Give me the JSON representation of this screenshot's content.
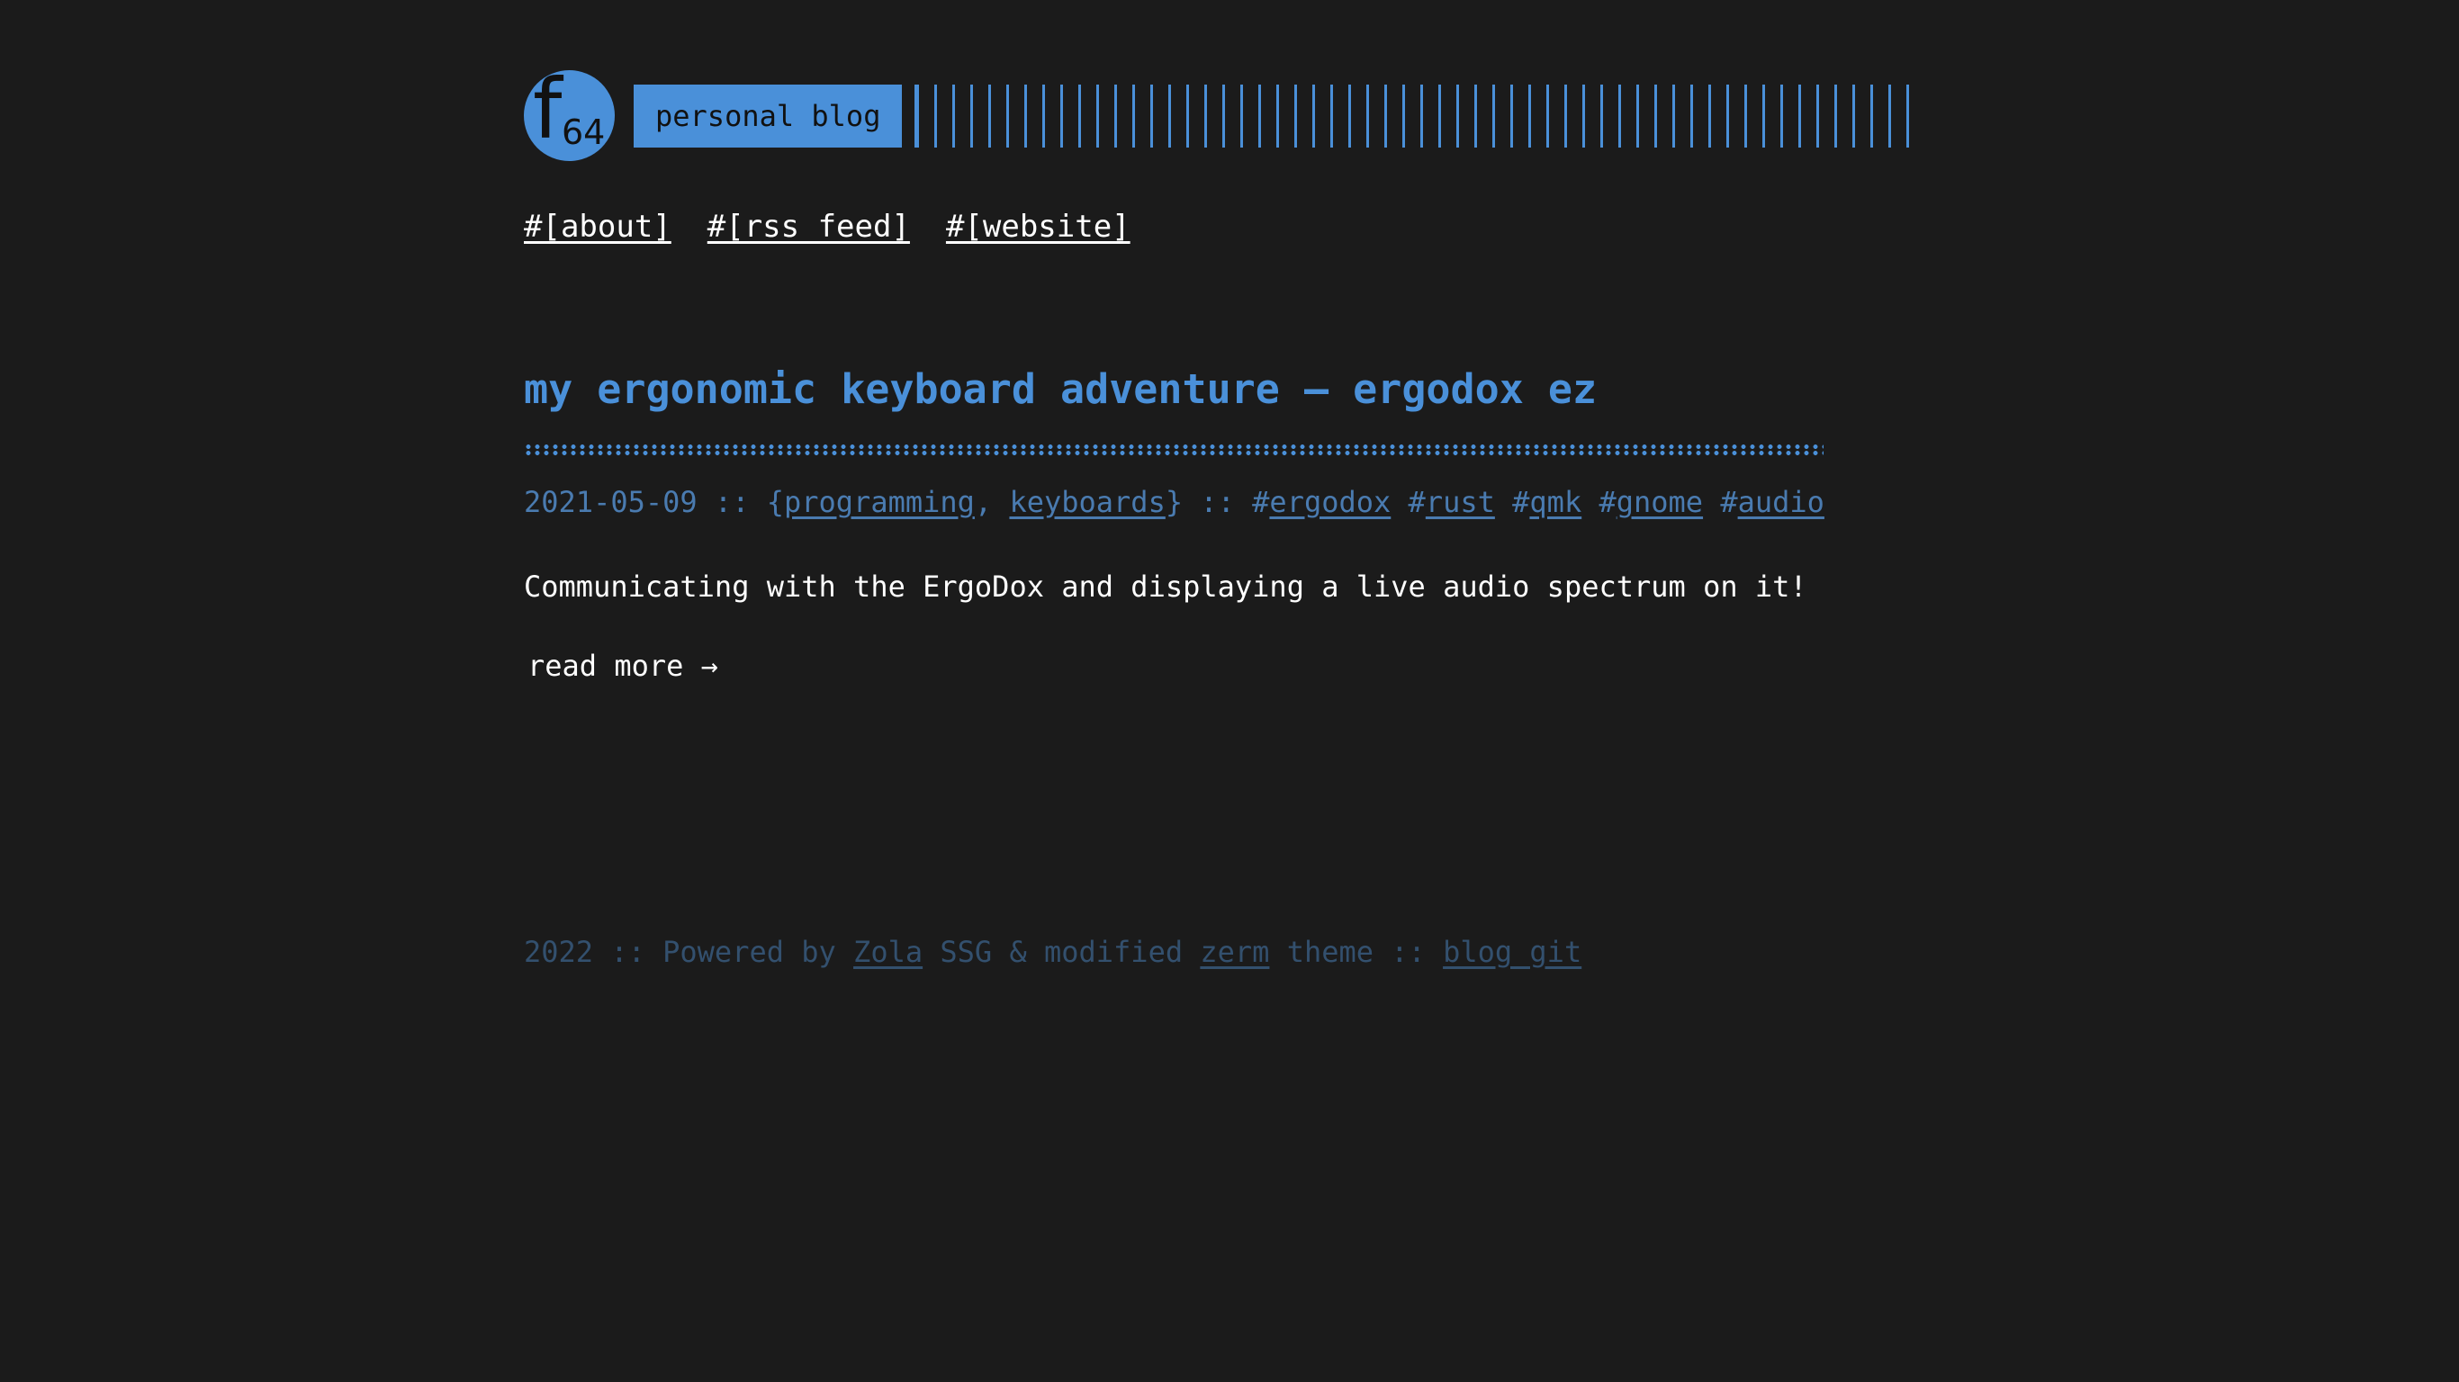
{
  "colors": {
    "background": "#1b1b1b",
    "accent": "#4a90d9",
    "meta": "#4a7bb0",
    "footer": "#33506e",
    "text": "#ffffff"
  },
  "header": {
    "logo_letter": "f",
    "logo_number": "64",
    "blog_label": "personal blog"
  },
  "nav": {
    "items": [
      {
        "label": "#[about]"
      },
      {
        "label": "#[rss_feed]"
      },
      {
        "label": "#[website]"
      }
    ]
  },
  "post": {
    "title": "my ergonomic keyboard adventure – ergodox ez",
    "date": "2021-05-09",
    "sep1": " :: {",
    "categories": [
      "programming",
      "keyboards"
    ],
    "cat_sep": ", ",
    "sep2": "} :: ",
    "tags": [
      "ergodox",
      "rust",
      "qmk",
      "gnome",
      "audio"
    ],
    "summary": "Communicating with the ErgoDox and displaying a live audio spectrum on it!",
    "read_more": "read more →"
  },
  "footer": {
    "year": "2022",
    "sep": " :: ",
    "powered_by": "Powered by ",
    "zola": "Zola",
    "middle": " SSG & modified ",
    "zerm": "zerm",
    "theme": " theme :: ",
    "blog_git": "blog_git"
  }
}
